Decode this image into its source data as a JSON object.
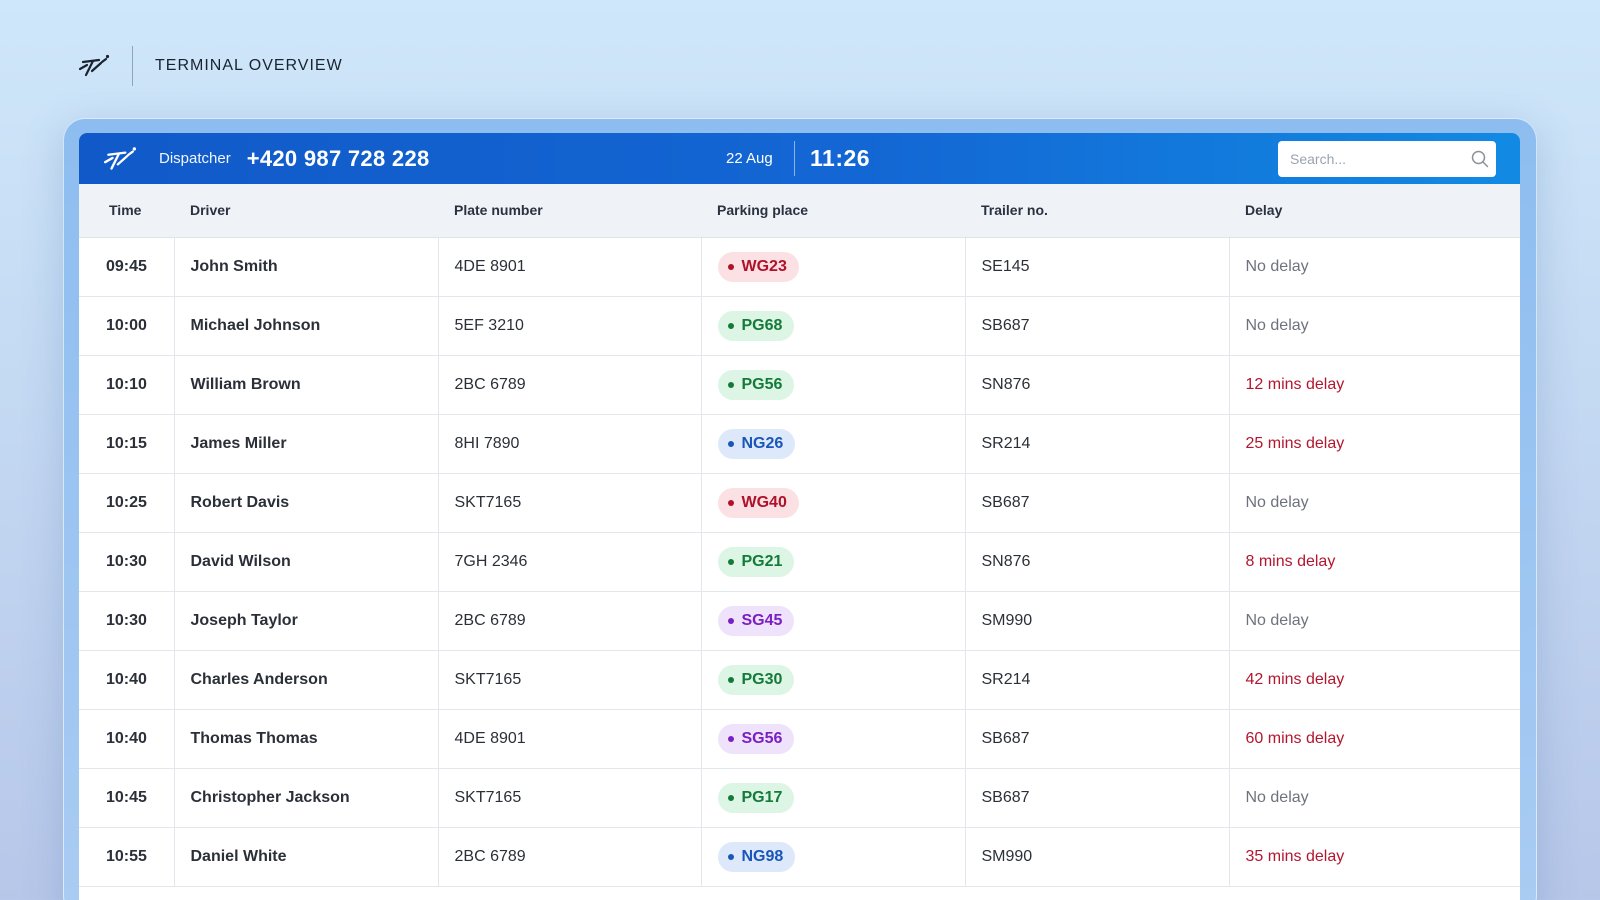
{
  "page": {
    "title": "TERMINAL OVERVIEW",
    "logo_icon": "stylized-logo-icon"
  },
  "header": {
    "dispatcher_label": "Dispatcher",
    "dispatcher_phone": "+420 987 728 228",
    "date": "22 Aug",
    "time": "11:26",
    "search_placeholder": "Search..."
  },
  "table": {
    "columns": [
      "Time",
      "Driver",
      "Plate number",
      "Parking place",
      "Trailer no.",
      "Delay"
    ],
    "rows": [
      {
        "time": "09:45",
        "driver": "John Smith",
        "plate": "4DE 8901",
        "parking": "WG23",
        "zone": "wg",
        "trailer": "SE145",
        "delay": "No delay",
        "late": false
      },
      {
        "time": "10:00",
        "driver": "Michael Johnson",
        "plate": "5EF 3210",
        "parking": "PG68",
        "zone": "pg",
        "trailer": "SB687",
        "delay": "No delay",
        "late": false
      },
      {
        "time": "10:10",
        "driver": "William Brown",
        "plate": "2BC 6789",
        "parking": "PG56",
        "zone": "pg",
        "trailer": "SN876",
        "delay": "12 mins delay",
        "late": true
      },
      {
        "time": "10:15",
        "driver": "James Miller",
        "plate": "8HI 7890",
        "parking": "NG26",
        "zone": "ng",
        "trailer": "SR214",
        "delay": "25 mins delay",
        "late": true
      },
      {
        "time": "10:25",
        "driver": "Robert Davis",
        "plate": "SKT7165",
        "parking": "WG40",
        "zone": "wg",
        "trailer": "SB687",
        "delay": "No delay",
        "late": false
      },
      {
        "time": "10:30",
        "driver": "David Wilson",
        "plate": "7GH 2346",
        "parking": "PG21",
        "zone": "pg",
        "trailer": "SN876",
        "delay": "8 mins delay",
        "late": true
      },
      {
        "time": "10:30",
        "driver": "Joseph Taylor",
        "plate": "2BC 6789",
        "parking": "SG45",
        "zone": "sg",
        "trailer": "SM990",
        "delay": "No delay",
        "late": false
      },
      {
        "time": "10:40",
        "driver": "Charles Anderson",
        "plate": "SKT7165",
        "parking": "PG30",
        "zone": "pg",
        "trailer": "SR214",
        "delay": "42 mins delay",
        "late": true
      },
      {
        "time": "10:40",
        "driver": "Thomas Thomas",
        "plate": "4DE 8901",
        "parking": "SG56",
        "zone": "sg",
        "trailer": "SB687",
        "delay": "60 mins delay",
        "late": true
      },
      {
        "time": "10:45",
        "driver": "Christopher Jackson",
        "plate": "SKT7165",
        "parking": "PG17",
        "zone": "pg",
        "trailer": "SB687",
        "delay": "No delay",
        "late": false
      },
      {
        "time": "10:55",
        "driver": "Daniel White",
        "plate": "2BC 6789",
        "parking": "NG98",
        "zone": "ng",
        "trailer": "SM990",
        "delay": "35 mins delay",
        "late": true
      }
    ]
  },
  "colors": {
    "header_gradient_start": "#1159c9",
    "header_gradient_end": "#128ae3",
    "delay_late": "#b3162e",
    "delay_none": "#6d737c",
    "zone_wg": "#b0112a",
    "zone_pg": "#147a3a",
    "zone_ng": "#1a55b8",
    "zone_sg": "#7a20c2"
  }
}
